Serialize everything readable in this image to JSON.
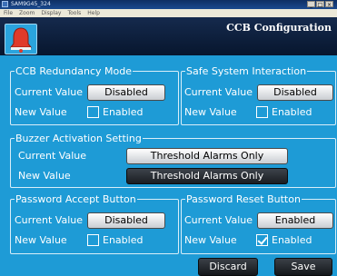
{
  "window": {
    "title": "SAM9G45_324",
    "menu": [
      "File",
      "Zoom",
      "Display",
      "Tools",
      "Help"
    ],
    "min_glyph": "_",
    "max_glyph": "□",
    "close_glyph": "×"
  },
  "header": {
    "title": "CCB Configuration"
  },
  "labels": {
    "current": "Current Value",
    "new": "New Value"
  },
  "groups": {
    "redundancy": {
      "title": "CCB Redundancy Mode",
      "current": "Disabled",
      "new_label": "Enabled",
      "new_checked": false
    },
    "safe": {
      "title": "Safe System Interaction",
      "current": "Disabled",
      "new_label": "Enabled",
      "new_checked": false
    },
    "buzzer": {
      "title": "Buzzer Activation Setting",
      "current": "Threshold Alarms Only",
      "new": "Threshold Alarms Only"
    },
    "pw_accept": {
      "title": "Password Accept Button",
      "current": "Disabled",
      "new_label": "Enabled",
      "new_checked": false
    },
    "pw_reset": {
      "title": "Password Reset Button",
      "current": "Enabled",
      "new_label": "Enabled",
      "new_checked": true
    }
  },
  "actions": {
    "discard": "Discard",
    "save": "Save"
  },
  "icons": {
    "logo": "bell-logo-icon"
  }
}
